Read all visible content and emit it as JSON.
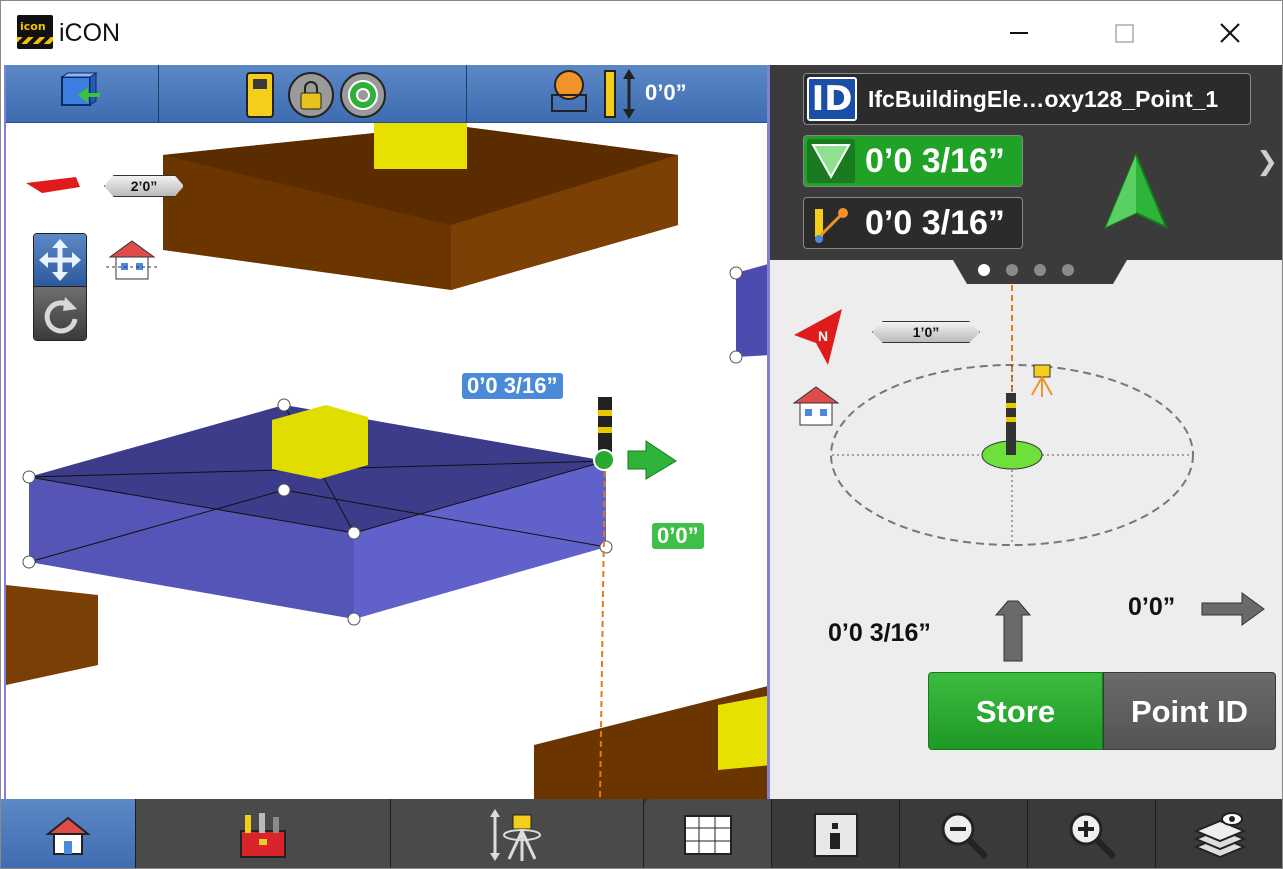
{
  "window": {
    "title": "iCON",
    "logo_text": "icon",
    "colors": {
      "accent_blue": "#3e6cb0",
      "green": "#22a12a",
      "dark": "#3b3b3b",
      "brown": "#6b3500",
      "indigo": "#5f5fbf"
    }
  },
  "toolbar": {
    "icons": [
      "select-object-icon",
      "total-station-icon",
      "lock-icon",
      "target-icon",
      "prism-icon",
      "height-icon"
    ],
    "height_value": "0’0”"
  },
  "map": {
    "scale_label": "2’0”",
    "point_distance_label": "0’0 3/16”",
    "height_offset_label": "0’0”"
  },
  "right_panel": {
    "point_id": "IfcBuildingEle…oxy128_Point_1",
    "id_badge": "ID",
    "cut_fill_value": "0’0 3/16”",
    "distance_value": "0’0 3/16”",
    "page_dots": 4,
    "scale_label": "1’0”",
    "forward_value": "0’0 3/16”",
    "right_value": "0’0”",
    "store_label": "Store",
    "point_id_label": "Point ID"
  },
  "bottom_tabs": [
    "home-icon",
    "toolbox-icon",
    "instrument-setup-icon",
    "data-table-icon",
    "info-icon",
    "zoom-out-icon",
    "zoom-in-icon",
    "layers-icon"
  ]
}
